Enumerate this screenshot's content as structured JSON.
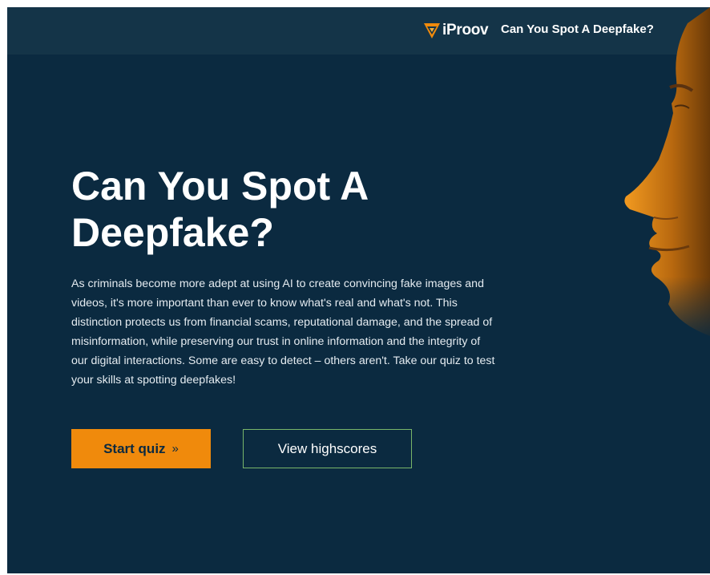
{
  "colors": {
    "background": "#0b2a40",
    "header": "#143448",
    "accent": "#f08a0c",
    "secondary_button_border": "#79b56a"
  },
  "header": {
    "logo_icon": "iproov-chevron-logo",
    "logo_text": "iProov",
    "title": "Can You Spot A Deepfake?"
  },
  "hero": {
    "image": "face-profile-illustration",
    "heading": "Can You Spot A Deepfake?",
    "intro": "As criminals become more adept at using AI to create convincing fake images and videos, it's more important than ever to know what's real and what's not. This distinction protects us from financial scams, reputational damage, and the spread of misinformation, while preserving our trust in online information and the integrity of our digital interactions. Some are easy to detect – others aren't. Take our quiz to test your skills at spotting deepfakes!"
  },
  "actions": {
    "start_label": "Start quiz",
    "start_icon": "double-chevron-right-icon",
    "start_arrow": "»",
    "highscores_label": "View highscores"
  }
}
